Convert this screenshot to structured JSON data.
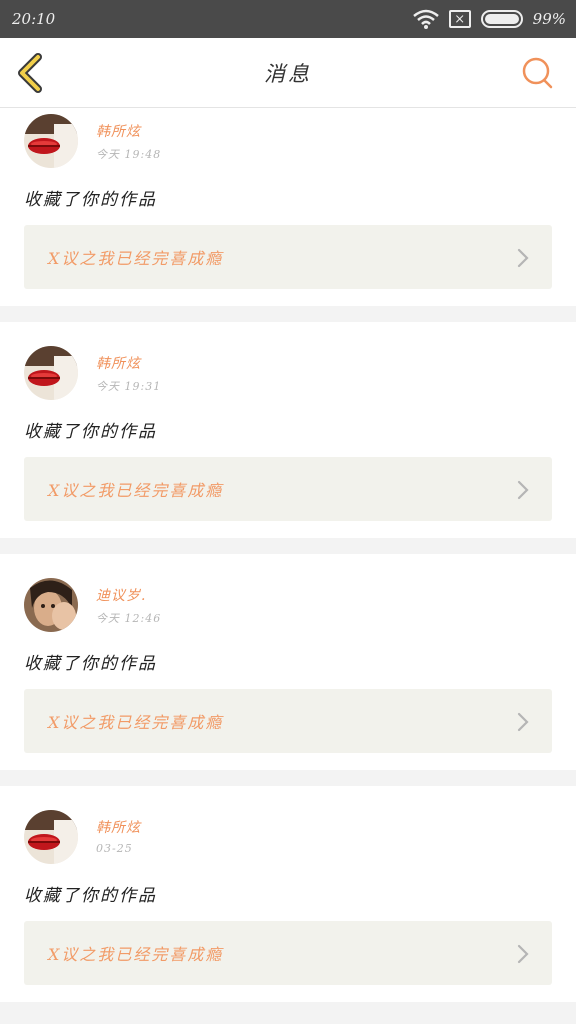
{
  "status_bar": {
    "time": "20:10",
    "sim_icon": "close-box",
    "battery_text": "99%"
  },
  "header": {
    "title": "消息",
    "back_icon": "chevron-left-icon",
    "search_icon": "search-icon"
  },
  "colors": {
    "accent": "#f0915a",
    "back_chevron": "#e8c23a",
    "card_box": "#f2f2ec"
  },
  "messages": [
    {
      "user": "韩所炫",
      "time": "今天 19:48",
      "action": "收藏了你的作品",
      "work_title": "X议之我已经完喜成瘾",
      "avatar": "red-lips"
    },
    {
      "user": "韩所炫",
      "time": "今天 19:31",
      "action": "收藏了你的作品",
      "work_title": "X议之我已经完喜成瘾",
      "avatar": "red-lips"
    },
    {
      "user": "迪议岁.",
      "time": "今天 12:46",
      "action": "收藏了你的作品",
      "work_title": "X议之我已经完喜成瘾",
      "avatar": "portrait"
    },
    {
      "user": "韩所炫",
      "time": "03-25",
      "action": "收藏了你的作品",
      "work_title": "X议之我已经完喜成瘾",
      "avatar": "red-lips"
    }
  ]
}
